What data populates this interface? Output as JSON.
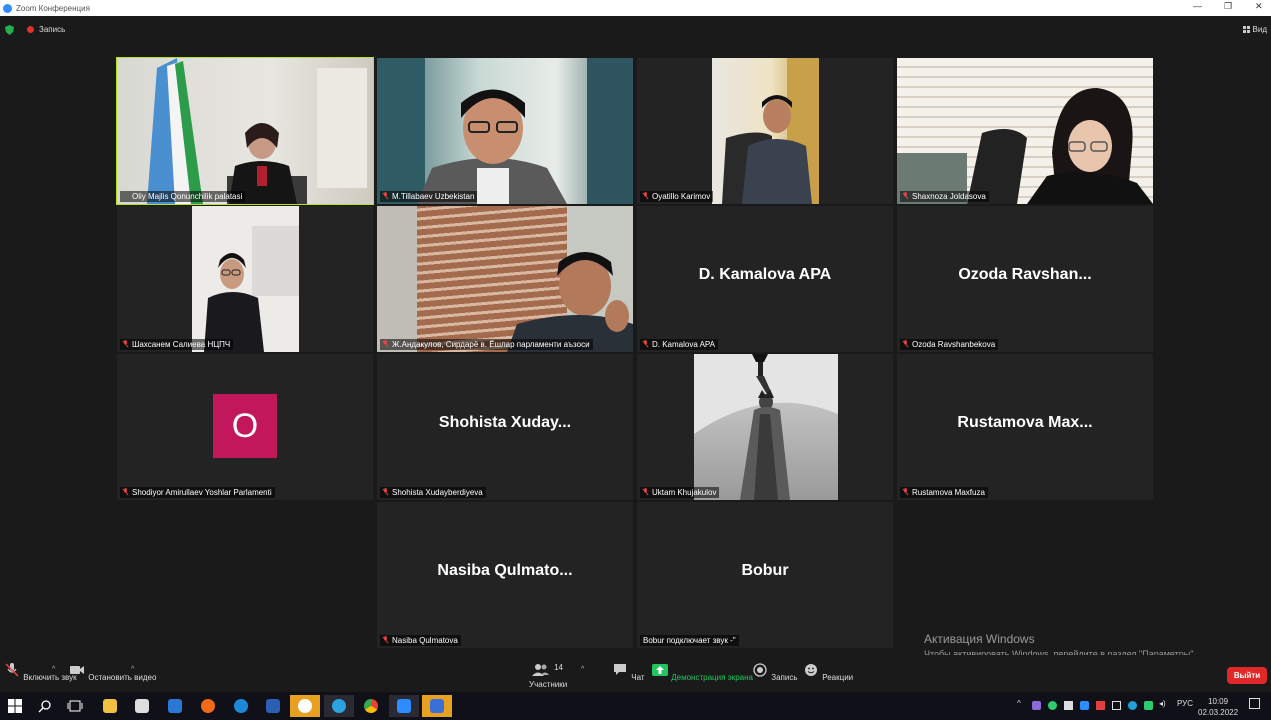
{
  "window": {
    "title": "Zoom Конференция"
  },
  "topbar": {
    "recording_label": "Запись",
    "view_label": "Вид"
  },
  "tiles": [
    {
      "name": "Oliy Majlis Qonunchilik palatasi",
      "video": "flag"
    },
    {
      "name": "M.Tillabaev Uzbekistan",
      "video": "man-glasses"
    },
    {
      "name": "Oyatillo Karimov",
      "video": "man-desk"
    },
    {
      "name": "Shaxnoza Joldasova",
      "video": "woman-glasses"
    },
    {
      "name": "Шахсанем Салиева НЦПЧ",
      "video": "woman-phone"
    },
    {
      "name": "Ж.Андакулов, Сирдарё в. Ёшлар парламенти аъзоси",
      "video": "man-blinds"
    },
    {
      "name": "D. Kamalova APA",
      "display": "D. Kamalova APA"
    },
    {
      "name": "Ozoda Ravshanbekova",
      "display": "Ozoda  Ravshan..."
    },
    {
      "name": "Shodiyor Amirullaev Yoshlar Parlamenti",
      "avatar": "O"
    },
    {
      "name": "Shohista Xudayberdiyeva",
      "display": "Shohista  Xuday..."
    },
    {
      "name": "Uktam Khujakulov",
      "video": "statue"
    },
    {
      "name": "Rustamova Maxfuza",
      "display": "Rustamova  Max..."
    },
    {
      "name": "Nasiba Qulmatova",
      "display": "Nasiba  Qulmato..."
    },
    {
      "name": "Bobur подключает звук -\"",
      "display": "Bobur"
    }
  ],
  "toolbar": {
    "unmute": "Включить звук",
    "stop_video": "Остановить видео",
    "participants_count": "14",
    "participants": "Участники",
    "chat": "Чат",
    "share": "Демонстрация экрана",
    "record": "Запись",
    "reactions": "Реакции",
    "leave": "Выйти"
  },
  "activation": {
    "line1": "Активация Windows",
    "line2": "Чтобы активировать Windows, перейдите в раздел \"Параметры\"."
  },
  "taskbar": {
    "lang": "РУС",
    "time": "10:09",
    "date": "02.03.2022"
  },
  "colors": {
    "active_speaker": "#b4e21f",
    "share_green": "#22c55e",
    "leave_red": "#e02828",
    "avatar_bg": "#c2185b"
  }
}
